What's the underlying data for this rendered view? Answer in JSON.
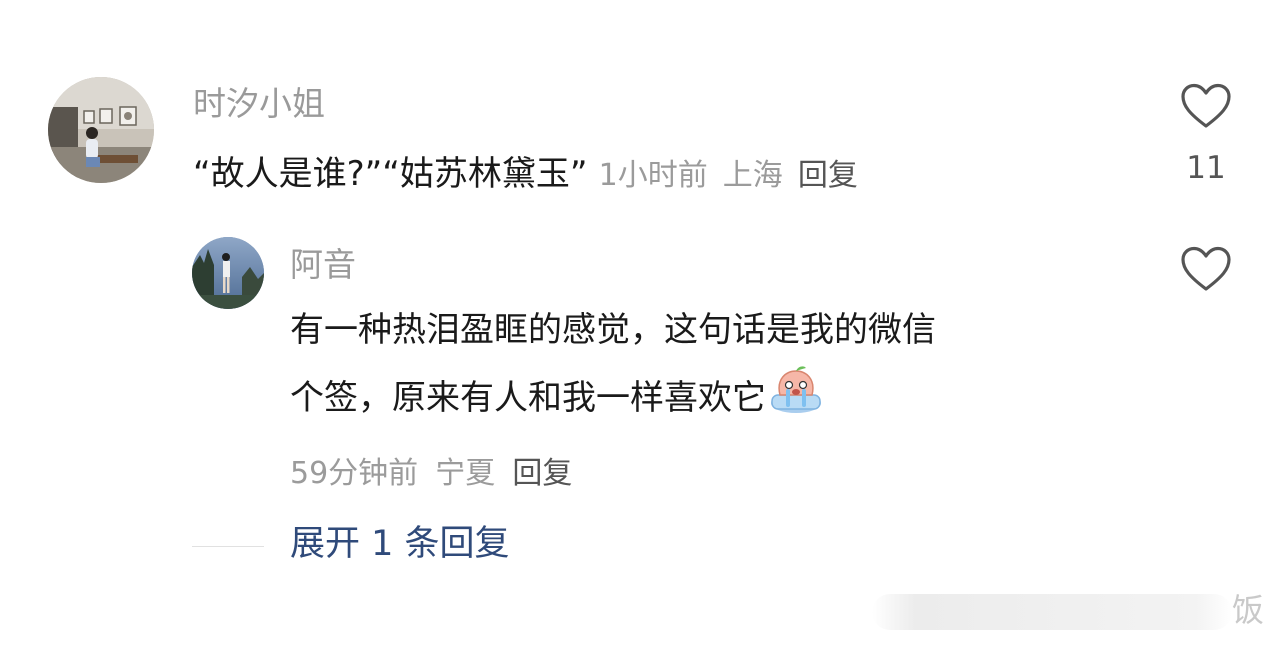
{
  "comment": {
    "username": "时汐小姐",
    "text": "“故人是谁?”“姑苏林黛玉”",
    "time": "1小时前",
    "location": "上海",
    "reply_label": "回复",
    "like_count": "11"
  },
  "reply": {
    "username": "阿音",
    "text_line1": "有一种热泪盈眶的感觉，这句话是我的微信",
    "text_line2": "个签，原来有人和我一样喜欢它",
    "time": "59分钟前",
    "location": "宁夏",
    "reply_label": "回复"
  },
  "expand": {
    "label": "展开 1 条回复"
  },
  "watermark": {
    "text": "饭"
  },
  "icons": {
    "like": "heart-outline-icon",
    "emoji": "crying-peach-emoji-icon"
  }
}
